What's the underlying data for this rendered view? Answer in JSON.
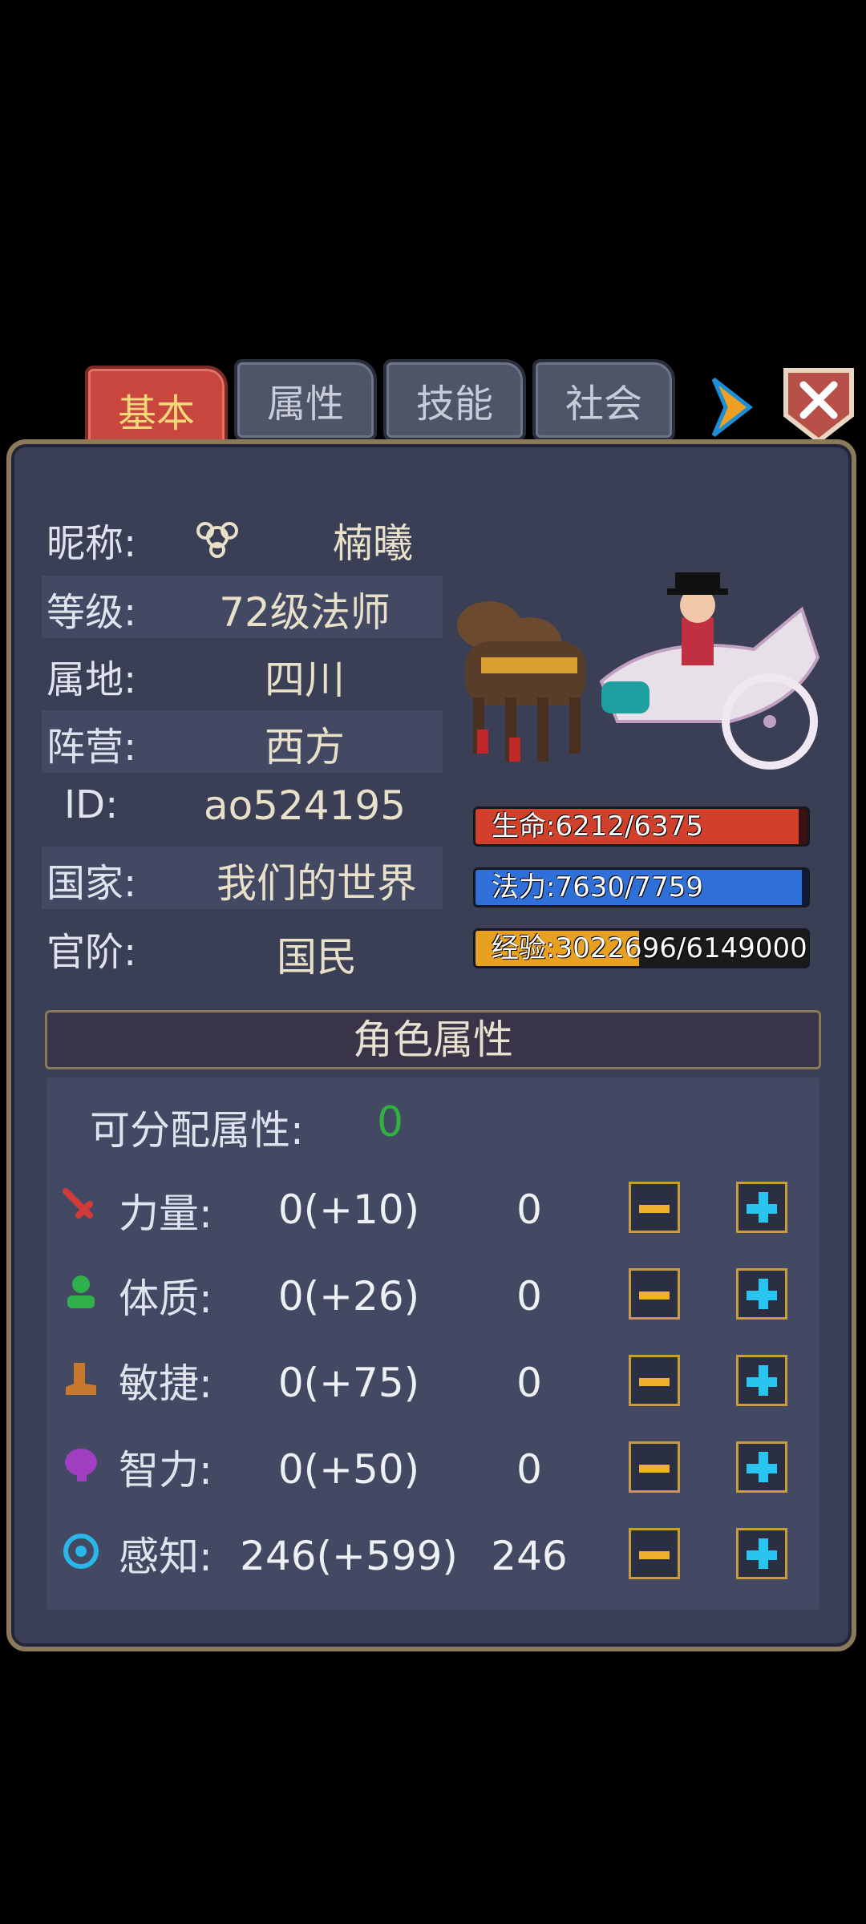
{
  "tabs": [
    {
      "label": "基本",
      "active": true
    },
    {
      "label": "属性",
      "active": false
    },
    {
      "label": "技能",
      "active": false
    },
    {
      "label": "社会",
      "active": false
    }
  ],
  "profile": {
    "nickname_label": "昵称:",
    "nickname": "楠曦",
    "level_label": "等级:",
    "level": "72级法师",
    "region_label": "属地:",
    "region": "四川",
    "camp_label": "阵营:",
    "camp": "西方",
    "id_label": "ID:",
    "id": "ao524195",
    "country_label": "国家:",
    "country": "我们的世界",
    "rank_label": "官阶:",
    "rank": "国民"
  },
  "bars": {
    "hp": {
      "text": "生命:6212/6375",
      "current": 6212,
      "max": 6375,
      "color": "#d0402a"
    },
    "mp": {
      "text": "法力:7630/7759",
      "current": 7630,
      "max": 7759,
      "color": "#2f6fd8"
    },
    "exp": {
      "text": "经验:3022696/6149000",
      "current": 3022696,
      "max": 6149000,
      "color": "#e8a020"
    }
  },
  "attributes": {
    "title": "角色属性",
    "free_label": "可分配属性:",
    "free_value": "0",
    "rows": [
      {
        "label": "力量:",
        "base": "0(+10)",
        "alloc": "0",
        "icon": "sword-icon",
        "color": "#d23a3a"
      },
      {
        "label": "体质:",
        "base": "0(+26)",
        "alloc": "0",
        "icon": "body-icon",
        "color": "#2fb04a"
      },
      {
        "label": "敏捷:",
        "base": "0(+75)",
        "alloc": "0",
        "icon": "boot-icon",
        "color": "#c8782c"
      },
      {
        "label": "智力:",
        "base": "0(+50)",
        "alloc": "0",
        "icon": "brain-icon",
        "color": "#a040c0"
      },
      {
        "label": "感知:",
        "base": "246(+599)",
        "alloc": "246",
        "icon": "eye-icon",
        "color": "#29b6e8"
      }
    ]
  }
}
